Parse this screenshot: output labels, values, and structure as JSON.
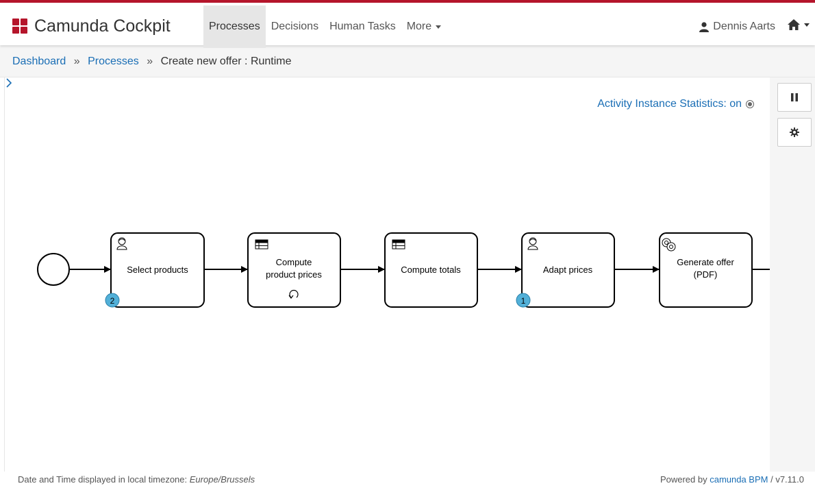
{
  "app": {
    "brand": "Camunda Cockpit"
  },
  "nav": {
    "items": [
      {
        "label": "Processes",
        "active": true
      },
      {
        "label": "Decisions",
        "active": false
      },
      {
        "label": "Human Tasks",
        "active": false
      },
      {
        "label": "More",
        "active": false
      }
    ],
    "user": "Dennis Aarts",
    "user_icon": "user-icon",
    "home_icon": "home-icon"
  },
  "breadcrumb": {
    "items": [
      "Dashboard",
      "Processes"
    ],
    "current": "Create new offer : Runtime",
    "separator": "»"
  },
  "canvas": {
    "stats_label": "Activity Instance Statistics: on",
    "expander": ">"
  },
  "toolbar": {
    "pause_icon": "pause-icon",
    "settings_icon": "gear-icon"
  },
  "diagram": {
    "tasks": [
      {
        "lines": [
          "Select products"
        ],
        "type": "user",
        "badge": "2"
      },
      {
        "lines": [
          "Compute",
          "product prices"
        ],
        "type": "business-rule",
        "marker": "loop"
      },
      {
        "lines": [
          "Compute totals"
        ],
        "type": "business-rule"
      },
      {
        "lines": [
          "Adapt prices"
        ],
        "type": "user",
        "badge": "1"
      },
      {
        "lines": [
          "Generate offer",
          "(PDF)"
        ],
        "type": "service"
      }
    ]
  },
  "footer": {
    "tz_prefix": "Date and Time displayed in local timezone: ",
    "tz_value": "Europe/Brussels",
    "powered_prefix": "Powered by ",
    "powered_link": "camunda BPM",
    "version": " / v7.11.0"
  },
  "colors": {
    "brand": "#b5152b",
    "link": "#1a6eb5",
    "badge": "#52b0d8"
  }
}
